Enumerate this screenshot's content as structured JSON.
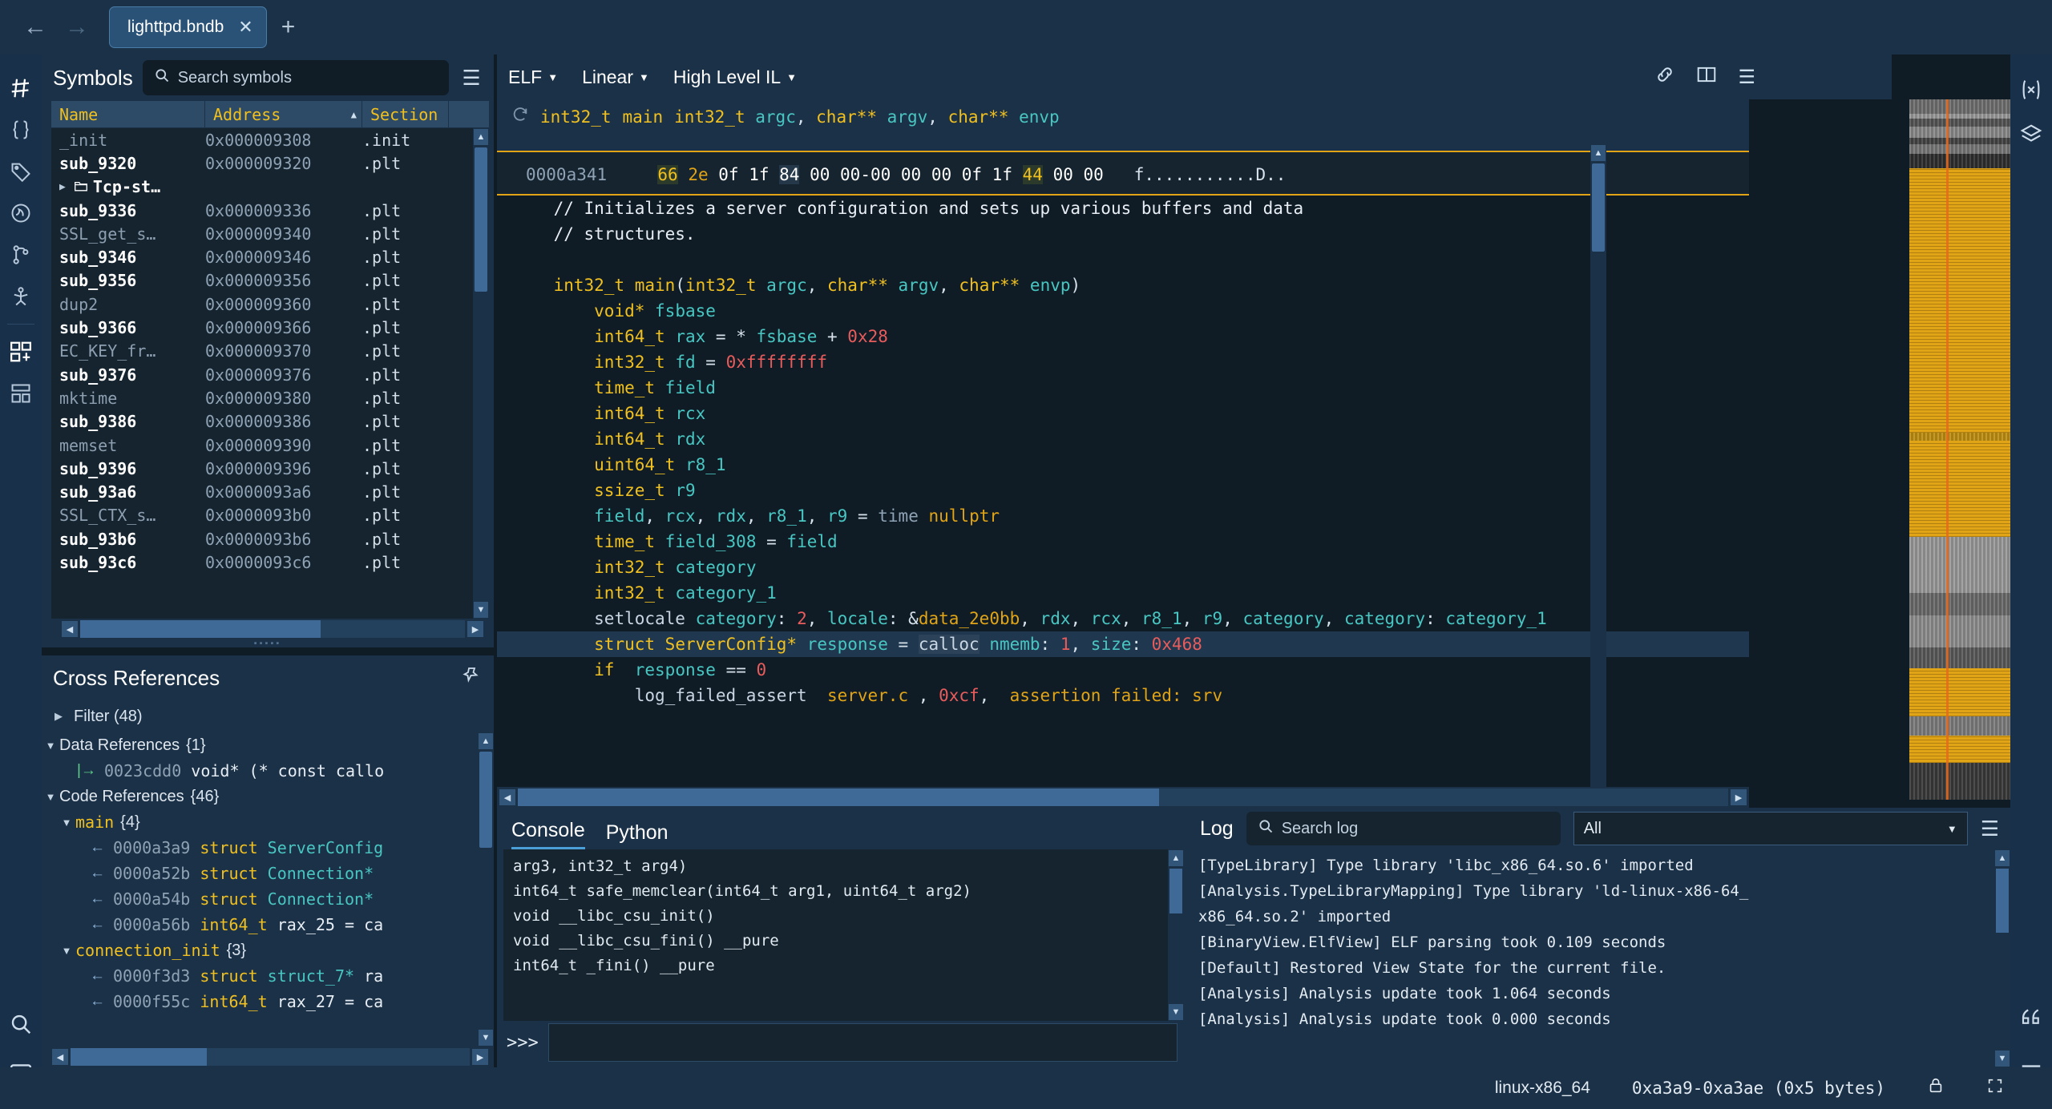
{
  "window": {
    "tab_title": "lighttpd.bndb",
    "back_icon": "back-arrow-icon",
    "forward_icon": "forward-arrow-icon",
    "close_tab_label": "✕",
    "new_tab_label": "+"
  },
  "symbols": {
    "title": "Symbols",
    "search_placeholder": "Search symbols",
    "menu_icon": "hamburger-menu-icon",
    "columns": [
      "Name",
      "Address",
      "Section"
    ],
    "rows": [
      {
        "name": "_init",
        "address": "0x000009308",
        "section": ".init",
        "kind": "import"
      },
      {
        "name": "sub_9320",
        "address": "0x000009320",
        "section": ".plt",
        "kind": "function"
      },
      {
        "name": "Tcp-st…",
        "address": "",
        "section": "",
        "kind": "folder"
      },
      {
        "name": "sub_9336",
        "address": "0x000009336",
        "section": ".plt",
        "kind": "function"
      },
      {
        "name": "SSL_get_s…",
        "address": "0x000009340",
        "section": ".plt",
        "kind": "import"
      },
      {
        "name": "sub_9346",
        "address": "0x000009346",
        "section": ".plt",
        "kind": "function"
      },
      {
        "name": "sub_9356",
        "address": "0x000009356",
        "section": ".plt",
        "kind": "function"
      },
      {
        "name": "dup2",
        "address": "0x000009360",
        "section": ".plt",
        "kind": "import"
      },
      {
        "name": "sub_9366",
        "address": "0x000009366",
        "section": ".plt",
        "kind": "function"
      },
      {
        "name": "EC_KEY_fr…",
        "address": "0x000009370",
        "section": ".plt",
        "kind": "import"
      },
      {
        "name": "sub_9376",
        "address": "0x000009376",
        "section": ".plt",
        "kind": "function"
      },
      {
        "name": "mktime",
        "address": "0x000009380",
        "section": ".plt",
        "kind": "import"
      },
      {
        "name": "sub_9386",
        "address": "0x000009386",
        "section": ".plt",
        "kind": "function"
      },
      {
        "name": "memset",
        "address": "0x000009390",
        "section": ".plt",
        "kind": "import"
      },
      {
        "name": "sub_9396",
        "address": "0x000009396",
        "section": ".plt",
        "kind": "function"
      },
      {
        "name": "sub_93a6",
        "address": "0x0000093a6",
        "section": ".plt",
        "kind": "function"
      },
      {
        "name": "SSL_CTX_s…",
        "address": "0x0000093b0",
        "section": ".plt",
        "kind": "import"
      },
      {
        "name": "sub_93b6",
        "address": "0x0000093b6",
        "section": ".plt",
        "kind": "function"
      },
      {
        "name": "sub_93c6",
        "address": "0x0000093c6",
        "section": ".plt",
        "kind": "function"
      }
    ]
  },
  "xrefs": {
    "title": "Cross References",
    "pin_icon": "pin-icon",
    "filter_label": "Filter (48)",
    "groups": [
      {
        "label": "Data References",
        "count": "{1}",
        "expanded": true
      },
      {
        "label": "Code References",
        "count": "{46}",
        "expanded": true
      }
    ],
    "data_refs": [
      {
        "address": "0023cdd0",
        "text": "void* (* const callo",
        "arrow": "data-arrow-icon"
      }
    ],
    "functions": [
      {
        "name": "main",
        "count": "{4}",
        "refs": [
          {
            "address": "0000a3a9",
            "kw": "struct",
            "type": "ServerConfig",
            "rest": ""
          },
          {
            "address": "0000a52b",
            "kw": "struct",
            "type": "Connection*",
            "rest": ""
          },
          {
            "address": "0000a54b",
            "kw": "struct",
            "type": "Connection*",
            "rest": ""
          },
          {
            "address": "0000a56b",
            "kw": "int64_t",
            "type": "",
            "rest": "rax_25 = ca"
          }
        ]
      },
      {
        "name": "connection_init",
        "count": "{3}",
        "refs": [
          {
            "address": "0000f3d3",
            "kw": "struct",
            "type": "struct_7*",
            "rest": "ra"
          },
          {
            "address": "0000f55c",
            "kw": "int64_t",
            "type": "",
            "rest": "rax_27 = ca"
          }
        ]
      }
    ]
  },
  "code": {
    "view_dropdowns": [
      {
        "label": "ELF"
      },
      {
        "label": "Linear"
      },
      {
        "label": "High Level IL"
      }
    ],
    "toolbar_icons": [
      "link-icon",
      "split-view-icon",
      "hamburger-menu-icon"
    ],
    "function_signature": {
      "refresh_icon": "refresh-icon",
      "ret_type": "int32_t",
      "name": "main",
      "params": "int32_t argc, char** argv, char** envp"
    },
    "hex_row": {
      "address": "0000a341",
      "bytes": "66 2e 0f 1f 84 00 00-00 00 00 0f 1f 44 00 00",
      "ascii": "f...........D.."
    },
    "lines": [
      {
        "t": "cmt",
        "text": "// Initializes a server configuration and sets up various buffers and data",
        "indent": 2
      },
      {
        "t": "cmt",
        "text": "// structures.",
        "indent": 2
      },
      {
        "t": "blank",
        "text": "",
        "indent": 0
      },
      {
        "t": "sig",
        "text": "int32_t main(int32_t argc, char** argv, char** envp)",
        "indent": 2
      },
      {
        "t": "decl",
        "text": "void* fsbase",
        "indent": 4
      },
      {
        "t": "decl",
        "text": "int64_t rax = * fsbase + 0x28",
        "indent": 4
      },
      {
        "t": "decl",
        "text": "int32_t fd = 0xffffffff",
        "indent": 4
      },
      {
        "t": "decl",
        "text": "time_t field",
        "indent": 4
      },
      {
        "t": "decl",
        "text": "int64_t rcx",
        "indent": 4
      },
      {
        "t": "decl",
        "text": "int64_t rdx",
        "indent": 4
      },
      {
        "t": "decl",
        "text": "uint64_t r8_1",
        "indent": 4
      },
      {
        "t": "decl",
        "text": "ssize_t r9",
        "indent": 4
      },
      {
        "t": "decl",
        "text": "field, rcx, rdx, r8_1, r9 = time nullptr",
        "indent": 4
      },
      {
        "t": "decl",
        "text": "time_t field_308 = field",
        "indent": 4
      },
      {
        "t": "decl",
        "text": "int32_t category",
        "indent": 4
      },
      {
        "t": "decl",
        "text": "int32_t category_1",
        "indent": 4
      },
      {
        "t": "call",
        "text": "setlocale category: 2, locale: &data_2e0bb, rdx, rcx, r8_1, r9, category, category: category_1",
        "indent": 4
      },
      {
        "t": "sel",
        "text": "struct ServerConfig* response = calloc nmemb: 1, size: 0x468",
        "indent": 4
      },
      {
        "t": "if",
        "text": "if  response == 0",
        "indent": 4
      },
      {
        "t": "assert",
        "text": "log_failed_assert  server.c , 0xcf,  assertion failed: srv",
        "indent": 6
      }
    ]
  },
  "console": {
    "tabs": [
      {
        "label": "Console",
        "active": true
      },
      {
        "label": "Python",
        "active": false
      }
    ],
    "output": [
      "arg3, int32_t arg4)",
      "int64_t safe_memclear(int64_t arg1, uint64_t arg2)",
      "void __libc_csu_init()",
      "void __libc_csu_fini() __pure",
      "int64_t _fini() __pure"
    ],
    "prompt_symbol": ">>>",
    "prompt_value": ""
  },
  "log": {
    "title": "Log",
    "search_placeholder": "Search log",
    "filter_value": "All",
    "menu_icon": "hamburger-menu-icon",
    "lines": [
      "[TypeLibrary] Type library 'libc_x86_64.so.6' imported",
      "[Analysis.TypeLibraryMapping] Type library 'ld-linux-x86-64_",
      "x86_64.so.2' imported",
      "[BinaryView.ElfView] ELF parsing took 0.109 seconds",
      "[Default] Restored View State for the current file.",
      "[Analysis] Analysis update took 1.064 seconds",
      "[Analysis] Analysis update took 0.000 seconds"
    ]
  },
  "status": {
    "platform": "linux-x86_64",
    "selection": "0xa3a9-0xa3ae (0x5 bytes)",
    "lock_icon": "lock-icon",
    "expand_icon": "expand-icon"
  },
  "rail": {
    "items": [
      {
        "icon": "symbols-hash-icon",
        "active": false
      },
      {
        "icon": "types-braces-icon",
        "active": false
      },
      {
        "icon": "tags-icon",
        "active": false
      },
      {
        "icon": "memory-map-icon",
        "active": false
      },
      {
        "icon": "branch-icon",
        "active": false
      },
      {
        "icon": "debugger-bug-icon",
        "active": false
      },
      {
        "icon": "components-icon",
        "active": true
      },
      {
        "icon": "stack-view-icon",
        "active": false
      }
    ],
    "bottom": [
      {
        "icon": "search-icon"
      },
      {
        "icon": "terminal-icon"
      }
    ]
  },
  "right_rail": {
    "items": [
      {
        "icon": "variables-icon"
      },
      {
        "icon": "layers-icon"
      }
    ],
    "bottom": [
      {
        "icon": "quotes-icon"
      },
      {
        "icon": "list-lines-icon"
      }
    ]
  },
  "colors": {
    "accent": "#e0a416",
    "panel": "#1b3147",
    "code_bg": "#0f1c26",
    "selection": "#1f384f",
    "type_token": "#49c6c2",
    "keyword_token": "#f0c020",
    "number_token": "#e85c5c"
  }
}
